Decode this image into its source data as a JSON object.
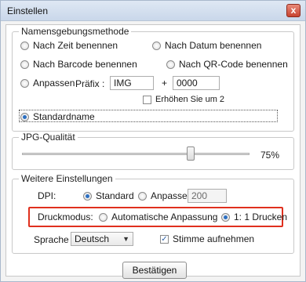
{
  "window": {
    "title": "Einstellen",
    "close_symbol": "x"
  },
  "naming": {
    "legend": "Namensgebungsmethode",
    "by_time": "Nach Zeit benennen",
    "by_date": "Nach Datum benennen",
    "by_barcode": "Nach Barcode benennen",
    "by_qrcode": "Nach QR-Code benennen",
    "custom": "Anpassen",
    "prefix_label": "Präfix :",
    "prefix_value": "IMG",
    "plus": "+",
    "counter_value": "0000",
    "increment_label": "Erhöhen Sie um 2",
    "default_name": "Standardname",
    "selected": "default_name"
  },
  "jpg": {
    "legend": "JPG-Qualität",
    "value": 75,
    "value_label": "75%"
  },
  "more": {
    "legend": "Weitere Einstellungen",
    "dpi_label": "DPI:",
    "dpi_standard": "Standard",
    "dpi_custom": "Anpassen",
    "dpi_value": "200",
    "dpi_selected": "standard",
    "print_label": "Druckmodus:",
    "print_auto": "Automatische Anpassung",
    "print_one_to_one": "1: 1 Drucken",
    "print_selected": "one_to_one",
    "language_label": "Sprache",
    "language_value": "Deutsch",
    "record_voice": "Stimme aufnehmen",
    "record_voice_checked": true
  },
  "confirm_button": "Bestätigen",
  "colors": {
    "highlight": "#e0301e",
    "radio_selected": "#2c6fc1"
  }
}
